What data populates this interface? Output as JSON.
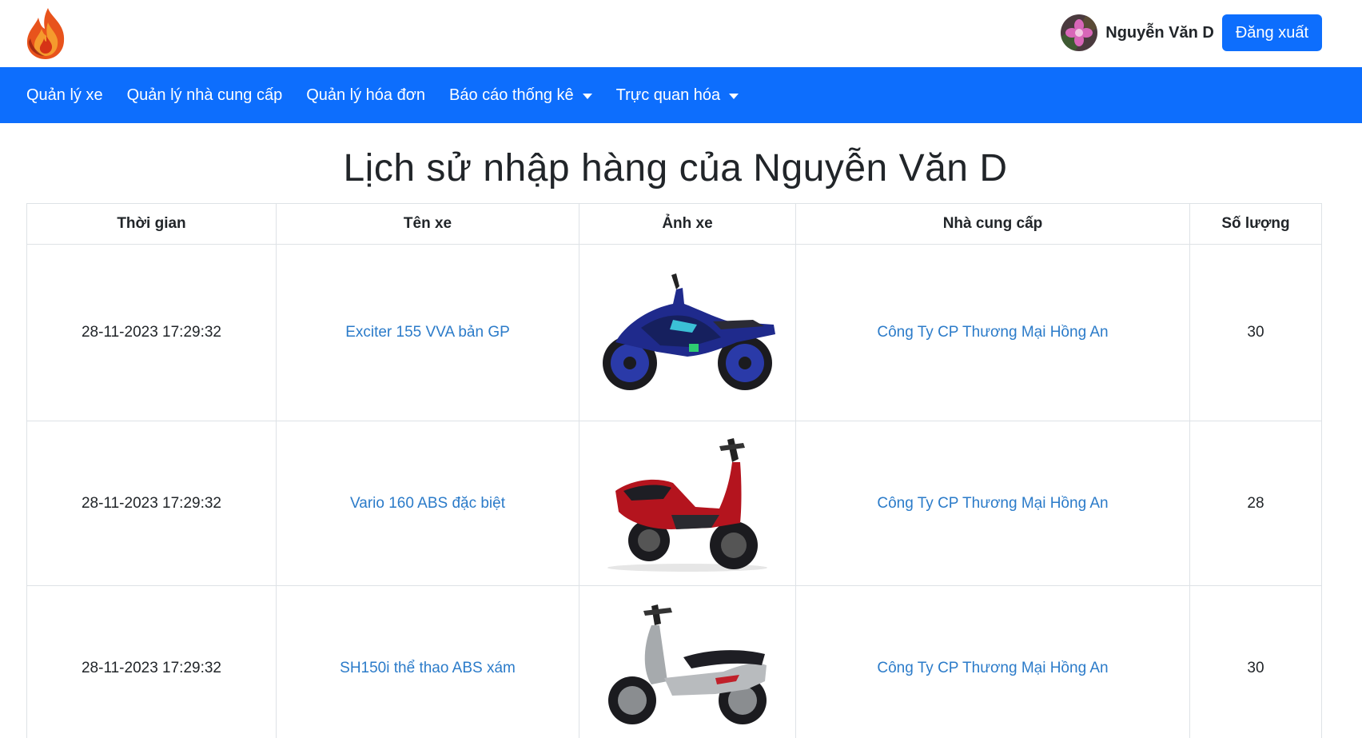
{
  "header": {
    "logo": "flame-logo",
    "user_name": "Nguyễn Văn D",
    "logout_label": "Đăng xuất"
  },
  "nav": {
    "items": [
      {
        "label": "Quản lý xe",
        "dropdown": false
      },
      {
        "label": "Quản lý nhà cung cấp",
        "dropdown": false
      },
      {
        "label": "Quản lý hóa đơn",
        "dropdown": false
      },
      {
        "label": "Báo cáo thống kê",
        "dropdown": true
      },
      {
        "label": "Trực quan hóa",
        "dropdown": true
      }
    ]
  },
  "page": {
    "title": "Lịch sử nhập hàng của Nguyễn Văn D"
  },
  "table": {
    "columns": [
      "Thời gian",
      "Tên xe",
      "Ảnh xe",
      "Nhà cung cấp",
      "Số lượng"
    ],
    "rows": [
      {
        "time": "28-11-2023 17:29:32",
        "bike_name": "Exciter 155 VVA bản GP",
        "image": "blue-sport-motorbike",
        "supplier": "Công Ty CP Thương Mại Hồng An",
        "quantity": "30"
      },
      {
        "time": "28-11-2023 17:29:32",
        "bike_name": "Vario 160 ABS đặc biệt",
        "image": "red-scooter",
        "supplier": "Công Ty CP Thương Mại Hồng An",
        "quantity": "28"
      },
      {
        "time": "28-11-2023 17:29:32",
        "bike_name": "SH150i thể thao ABS xám",
        "image": "grey-scooter",
        "supplier": "Công Ty CP Thương Mại Hồng An",
        "quantity": "30"
      }
    ]
  },
  "colors": {
    "primary": "#0d6efd",
    "link": "#2b7bc9",
    "border": "#dee2e6"
  }
}
